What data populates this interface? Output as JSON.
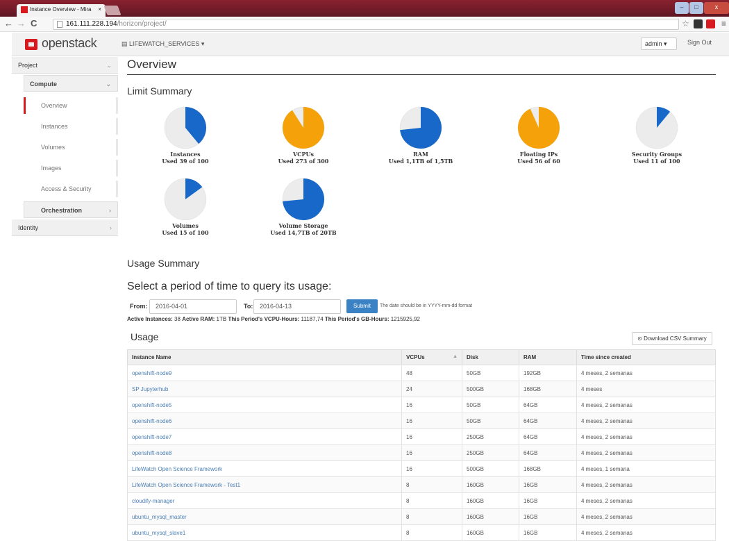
{
  "browser": {
    "tab_title": "Instance Overview - Mira",
    "tab_close": "×",
    "url_host": "161.111.228.194",
    "url_path": "/horizon/project/",
    "win_min": "–",
    "win_max": "□",
    "win_close": "x"
  },
  "header": {
    "logo": "openstack",
    "project": "LIFEWATCH_SERVICES",
    "user": "admin",
    "signout": "Sign Out"
  },
  "sidebar": {
    "project": "Project",
    "compute": "Compute",
    "items": [
      "Overview",
      "Instances",
      "Volumes",
      "Images",
      "Access & Security"
    ],
    "orchestration": "Orchestration",
    "identity": "Identity"
  },
  "page": {
    "title": "Overview",
    "limit_summary": "Limit Summary",
    "usage_summary": "Usage Summary",
    "period_heading": "Select a period of time to query its usage:"
  },
  "limits": [
    {
      "name": "Instances",
      "used_text": "Used 39 of 100",
      "fraction": 0.39,
      "color": "#1768c8"
    },
    {
      "name": "VCPUs",
      "used_text": "Used 273 of 300",
      "fraction": 0.91,
      "color": "#f5a20a"
    },
    {
      "name": "RAM",
      "used_text": "Used 1,1TB of 1,5TB",
      "fraction": 0.733,
      "color": "#1768c8"
    },
    {
      "name": "Floating IPs",
      "used_text": "Used 56 of 60",
      "fraction": 0.933,
      "color": "#f5a20a"
    },
    {
      "name": "Security Groups",
      "used_text": "Used 11 of 100",
      "fraction": 0.11,
      "color": "#1768c8"
    },
    {
      "name": "Volumes",
      "used_text": "Used 15 of 100",
      "fraction": 0.15,
      "color": "#1768c8"
    },
    {
      "name": "Volume Storage",
      "used_text": "Used 14,7TB of 20TB",
      "fraction": 0.735,
      "color": "#1768c8"
    }
  ],
  "form": {
    "from_label": "From:",
    "from_value": "2016-04-01",
    "to_label": "To:",
    "to_value": "2016-04-13",
    "submit": "Submit",
    "help": "The date should be in YYYY-mm-dd format"
  },
  "stats": {
    "active_instances_label": "Active Instances:",
    "active_instances": "38",
    "active_ram_label": "Active RAM:",
    "active_ram": "1TB",
    "vcpu_hours_label": "This Period's VCPU-Hours:",
    "vcpu_hours": "11187,74",
    "gb_hours_label": "This Period's GB-Hours:",
    "gb_hours": "1215925,92"
  },
  "usage": {
    "heading": "Usage",
    "csv_button": "Download CSV Summary",
    "columns": [
      "Instance Name",
      "VCPUs",
      "Disk",
      "RAM",
      "Time since created"
    ],
    "rows": [
      [
        "openshift-node9",
        "48",
        "50GB",
        "192GB",
        "4 meses, 2 semanas"
      ],
      [
        "SP Jupyterhub",
        "24",
        "500GB",
        "168GB",
        "4 meses"
      ],
      [
        "openshift-node5",
        "16",
        "50GB",
        "64GB",
        "4 meses, 2 semanas"
      ],
      [
        "openshift-node6",
        "16",
        "50GB",
        "64GB",
        "4 meses, 2 semanas"
      ],
      [
        "openshift-node7",
        "16",
        "250GB",
        "64GB",
        "4 meses, 2 semanas"
      ],
      [
        "openshift-node8",
        "16",
        "250GB",
        "64GB",
        "4 meses, 2 semanas"
      ],
      [
        "LifeWatch Open Science Framework",
        "16",
        "500GB",
        "168GB",
        "4 meses, 1 semana"
      ],
      [
        "LifeWatch Open Science Framework - Test1",
        "8",
        "160GB",
        "16GB",
        "4 meses, 2 semanas"
      ],
      [
        "cloudify-manager",
        "8",
        "160GB",
        "16GB",
        "4 meses, 2 semanas"
      ],
      [
        "ubuntu_mysql_master",
        "8",
        "160GB",
        "16GB",
        "4 meses, 2 semanas"
      ],
      [
        "ubuntu_mysql_slave1",
        "8",
        "160GB",
        "16GB",
        "4 meses, 2 semanas"
      ]
    ]
  }
}
